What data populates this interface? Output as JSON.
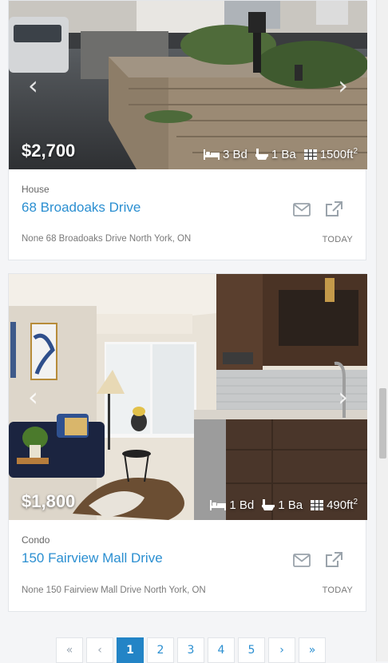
{
  "listings": [
    {
      "price": "$2,700",
      "beds": "3 Bd",
      "baths": "1 Ba",
      "area": "1500ft",
      "area_sup": "2",
      "type": "House",
      "title": "68 Broadoaks Drive",
      "address": "None 68 Broadoaks Drive North York, ON",
      "date": "TODAY"
    },
    {
      "price": "$1,800",
      "beds": "1 Bd",
      "baths": "1 Ba",
      "area": "490ft",
      "area_sup": "2",
      "type": "Condo",
      "title": "150 Fairview Mall Drive",
      "address": "None 150 Fairview Mall Drive North York, ON",
      "date": "TODAY"
    }
  ],
  "carousel": {
    "prev": "‹",
    "next": "›"
  },
  "pagination": {
    "first": "«",
    "prev": "‹",
    "pages": [
      "1",
      "2",
      "3",
      "4",
      "5"
    ],
    "next": "›",
    "last": "»",
    "current": "1"
  },
  "colors": {
    "link": "#2b8fd1",
    "active_page": "#2384c6"
  },
  "icons": [
    "bed-icon",
    "bath-icon",
    "area-icon",
    "envelope-icon",
    "external-link-icon"
  ]
}
